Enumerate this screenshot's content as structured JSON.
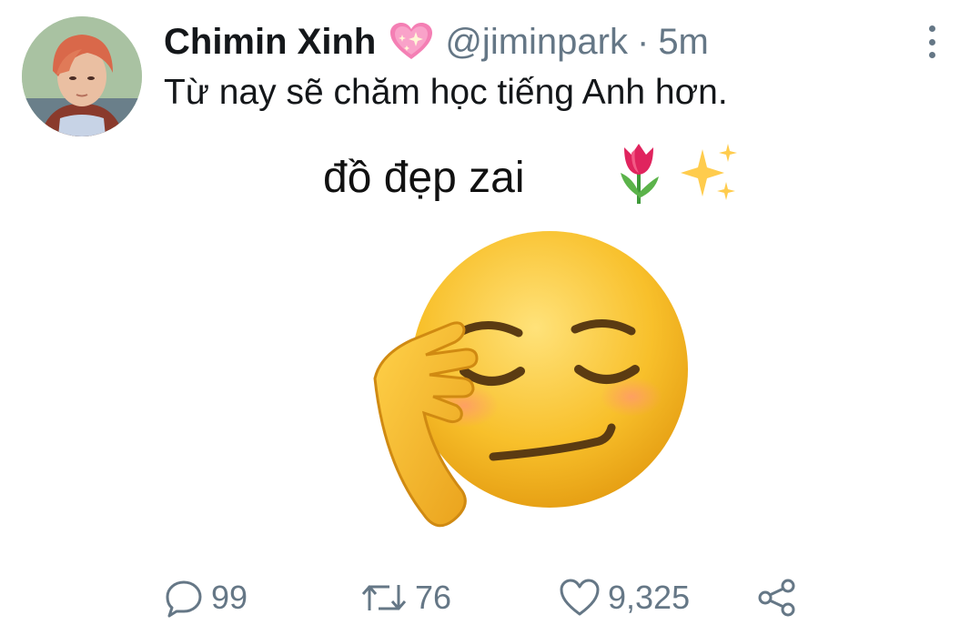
{
  "tweet": {
    "author": {
      "display_name": "Chimin Xinh",
      "name_emoji": "sparkling-heart-emoji",
      "handle": "@jiminpark",
      "separator": "·",
      "time": "5m"
    },
    "text": "Từ nay sẽ chăm học tiếng Anh hơn.",
    "media": {
      "caption": "đồ đẹp zai",
      "caption_emojis": [
        "tulip-emoji",
        "sparkles-emoji"
      ],
      "image": "smirking-salute-face-emoji"
    },
    "stats": {
      "replies": "99",
      "retweets": "76",
      "likes": "9,325"
    },
    "icons": {
      "reply": "reply-icon",
      "retweet": "retweet-icon",
      "like": "heart-icon",
      "share": "share-icon",
      "more": "more-options-icon"
    },
    "colors": {
      "text": "#14171a",
      "secondary": "#657786",
      "background": "#ffffff"
    }
  }
}
